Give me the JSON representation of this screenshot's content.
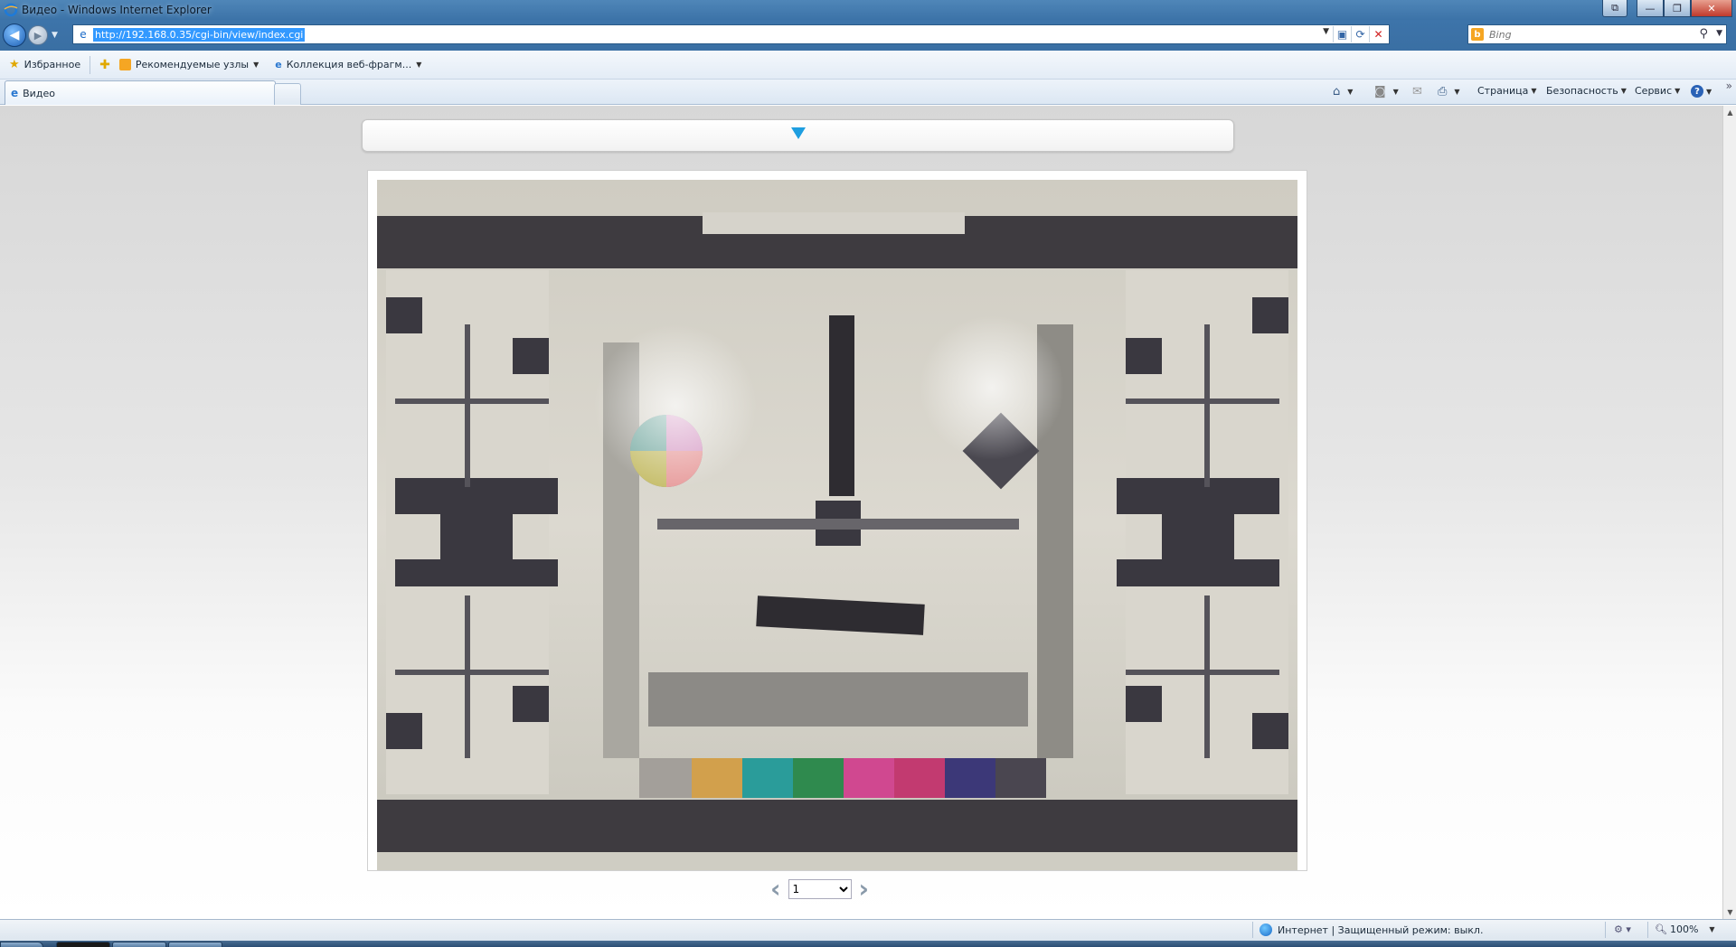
{
  "window": {
    "title": "Видео - Windows Internet Explorer",
    "controls": [
      "⧉",
      "—",
      "❐",
      "✕"
    ]
  },
  "navigation": {
    "address": "http://192.168.0.35/cgi-bin/view/index.cgi",
    "search": {
      "placeholder": "Bing"
    }
  },
  "favorites_bar": {
    "favorites_label": "Избранное",
    "items": [
      {
        "label": "Рекомендуемые узлы",
        "icon": "orange-feed-icon"
      },
      {
        "label": "Коллекция веб-фрагм...",
        "icon": "ie-page-icon"
      }
    ]
  },
  "tabs": [
    {
      "label": "Видео",
      "active": true
    }
  ],
  "command_bar": {
    "page_label": "Страница",
    "safety_label": "Безопасность",
    "tools_label": "Сервис"
  },
  "content": {
    "pager": {
      "selected": "1",
      "options": [
        "1"
      ]
    },
    "accent_color": "#1e9ee0"
  },
  "status_bar": {
    "zone_text": "Интернет | Защищенный режим: выкл.",
    "zoom": "100%"
  }
}
